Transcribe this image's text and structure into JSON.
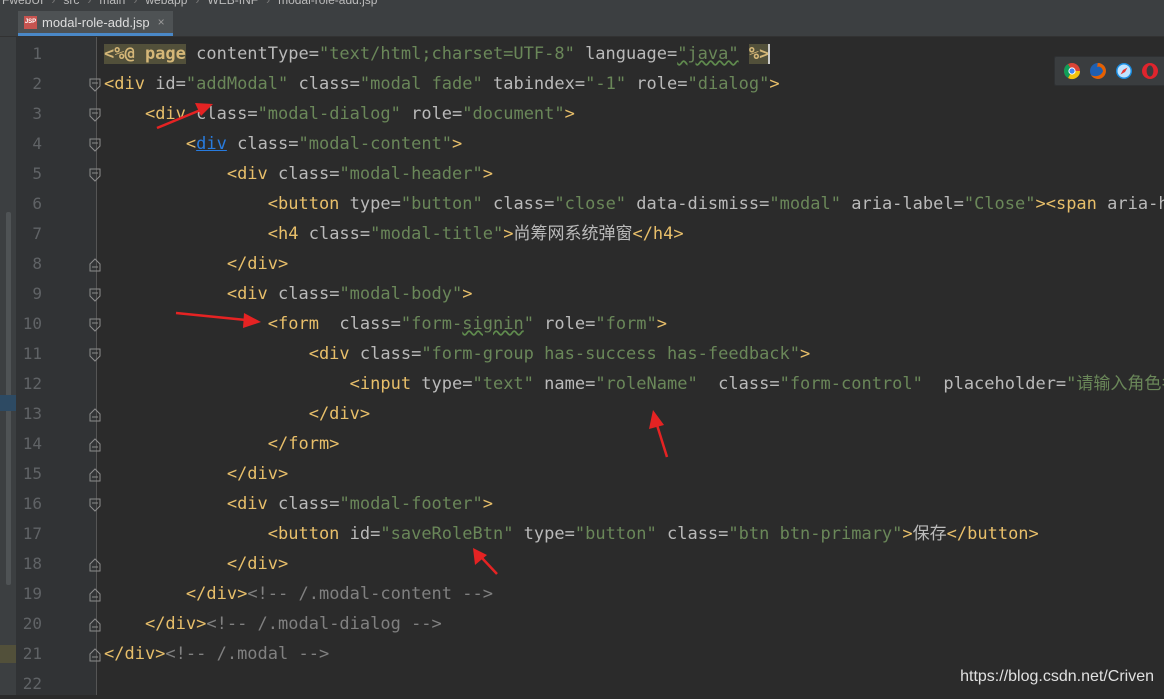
{
  "breadcrumb": [
    "FwebUI",
    "src",
    "main",
    "webapp",
    "WEB-INF",
    "modal-role-add.jsp"
  ],
  "tab": {
    "icon_label": "JSP",
    "label": "modal-role-add.jsp",
    "close": "×"
  },
  "browser_icons": [
    "chrome-icon",
    "firefox-icon",
    "safari-icon",
    "opera-icon"
  ],
  "watermark": "https://blog.csdn.net/Criven",
  "lines": [
    {
      "num": "1",
      "fold": "",
      "tokens": [
        [
          "hl",
          "<%@ page"
        ],
        [
          "a",
          " contentType="
        ],
        [
          "v",
          "\"text/html;charset=UTF-8\""
        ],
        [
          "a",
          " language="
        ],
        [
          "vt",
          "\"java\""
        ],
        [
          "a",
          " "
        ],
        [
          "hl",
          "%>"
        ],
        [
          "cur",
          ""
        ]
      ]
    },
    {
      "num": "2",
      "fold": "open",
      "tokens": [
        [
          "t",
          "<div"
        ],
        [
          "a",
          " id="
        ],
        [
          "v",
          "\"addModal\""
        ],
        [
          "a",
          " class="
        ],
        [
          "v",
          "\"modal fade\""
        ],
        [
          "a",
          " tabindex="
        ],
        [
          "v",
          "\"-1\""
        ],
        [
          "a",
          " role="
        ],
        [
          "v",
          "\"dialog\""
        ],
        [
          "t",
          ">"
        ]
      ]
    },
    {
      "num": "3",
      "fold": "open",
      "tokens": [
        [
          "p",
          "    "
        ],
        [
          "t",
          "<div"
        ],
        [
          "a",
          " class="
        ],
        [
          "v",
          "\"modal-dialog\""
        ],
        [
          "a",
          " role="
        ],
        [
          "v",
          "\"document\""
        ],
        [
          "t",
          ">"
        ]
      ]
    },
    {
      "num": "4",
      "fold": "open",
      "tokens": [
        [
          "p",
          "        "
        ],
        [
          "t",
          "<"
        ],
        [
          "l",
          "div"
        ],
        [
          "a",
          " class="
        ],
        [
          "v",
          "\"modal-content\""
        ],
        [
          "t",
          ">"
        ]
      ]
    },
    {
      "num": "5",
      "fold": "open",
      "tokens": [
        [
          "p",
          "            "
        ],
        [
          "t",
          "<div"
        ],
        [
          "a",
          " class="
        ],
        [
          "v",
          "\"modal-header\""
        ],
        [
          "t",
          ">"
        ]
      ]
    },
    {
      "num": "6",
      "fold": "",
      "tokens": [
        [
          "p",
          "                "
        ],
        [
          "t",
          "<button"
        ],
        [
          "a",
          " type="
        ],
        [
          "v",
          "\"button\""
        ],
        [
          "a",
          " class="
        ],
        [
          "v",
          "\"close\""
        ],
        [
          "a",
          " data-dismiss="
        ],
        [
          "v",
          "\"modal\""
        ],
        [
          "a",
          " aria-label="
        ],
        [
          "v",
          "\"Close\""
        ],
        [
          "t",
          "><span"
        ],
        [
          "a",
          " aria-hid"
        ]
      ]
    },
    {
      "num": "7",
      "fold": "",
      "tokens": [
        [
          "p",
          "                "
        ],
        [
          "t",
          "<h4"
        ],
        [
          "a",
          " class="
        ],
        [
          "v",
          "\"modal-title\""
        ],
        [
          "t",
          ">"
        ],
        [
          "x",
          "尚筹网系统弹窗"
        ],
        [
          "t",
          "</h4>"
        ]
      ]
    },
    {
      "num": "8",
      "fold": "close",
      "tokens": [
        [
          "p",
          "            "
        ],
        [
          "t",
          "</div>"
        ]
      ]
    },
    {
      "num": "9",
      "fold": "open",
      "tokens": [
        [
          "p",
          "            "
        ],
        [
          "t",
          "<div"
        ],
        [
          "a",
          " class="
        ],
        [
          "v",
          "\"modal-body\""
        ],
        [
          "t",
          ">"
        ]
      ]
    },
    {
      "num": "10",
      "fold": "open",
      "tokens": [
        [
          "p",
          "                "
        ],
        [
          "t",
          "<form"
        ],
        [
          "a",
          "  class="
        ],
        [
          "v",
          "\"form-"
        ],
        [
          "vt",
          "signin"
        ],
        [
          "v",
          "\""
        ],
        [
          "a",
          " role="
        ],
        [
          "v",
          "\"form\""
        ],
        [
          "t",
          ">"
        ]
      ]
    },
    {
      "num": "11",
      "fold": "open",
      "tokens": [
        [
          "p",
          "                    "
        ],
        [
          "t",
          "<div"
        ],
        [
          "a",
          " class="
        ],
        [
          "v",
          "\"form-group has-success has-feedback\""
        ],
        [
          "t",
          ">"
        ]
      ]
    },
    {
      "num": "12",
      "fold": "",
      "tokens": [
        [
          "p",
          "                        "
        ],
        [
          "t",
          "<input"
        ],
        [
          "a",
          " type="
        ],
        [
          "v",
          "\"text\""
        ],
        [
          "a",
          " name="
        ],
        [
          "v",
          "\"roleName\""
        ],
        [
          "a",
          "  class="
        ],
        [
          "v",
          "\"form-control\""
        ],
        [
          "a",
          "  placeholder="
        ],
        [
          "v",
          "\"请输入角色名"
        ]
      ]
    },
    {
      "num": "13",
      "fold": "close",
      "tokens": [
        [
          "p",
          "                    "
        ],
        [
          "t",
          "</div>"
        ]
      ]
    },
    {
      "num": "14",
      "fold": "close",
      "tokens": [
        [
          "p",
          "                "
        ],
        [
          "t",
          "</form>"
        ]
      ]
    },
    {
      "num": "15",
      "fold": "close",
      "tokens": [
        [
          "p",
          "            "
        ],
        [
          "t",
          "</div>"
        ]
      ]
    },
    {
      "num": "16",
      "fold": "open",
      "tokens": [
        [
          "p",
          "            "
        ],
        [
          "t",
          "<div"
        ],
        [
          "a",
          " class="
        ],
        [
          "v",
          "\"modal-footer\""
        ],
        [
          "t",
          ">"
        ]
      ]
    },
    {
      "num": "17",
      "fold": "",
      "tokens": [
        [
          "p",
          "                "
        ],
        [
          "t",
          "<button"
        ],
        [
          "a",
          " id="
        ],
        [
          "v",
          "\"saveRoleBtn\""
        ],
        [
          "a",
          " type="
        ],
        [
          "v",
          "\"button\""
        ],
        [
          "a",
          " class="
        ],
        [
          "v",
          "\"btn btn-primary\""
        ],
        [
          "t",
          ">"
        ],
        [
          "x",
          "保存"
        ],
        [
          "t",
          "</button>"
        ]
      ]
    },
    {
      "num": "18",
      "fold": "close",
      "tokens": [
        [
          "p",
          "            "
        ],
        [
          "t",
          "</div>"
        ]
      ]
    },
    {
      "num": "19",
      "fold": "close",
      "tokens": [
        [
          "p",
          "        "
        ],
        [
          "t",
          "</div>"
        ],
        [
          "c",
          "<!-- /.modal-content -->"
        ]
      ]
    },
    {
      "num": "20",
      "fold": "close",
      "tokens": [
        [
          "p",
          "    "
        ],
        [
          "t",
          "</div>"
        ],
        [
          "c",
          "<!-- /.modal-dialog -->"
        ]
      ]
    },
    {
      "num": "21",
      "fold": "close",
      "tokens": [
        [
          "t",
          "</div>"
        ],
        [
          "c",
          "<!-- /.modal -->"
        ]
      ]
    },
    {
      "num": "22",
      "fold": "",
      "tokens": []
    }
  ]
}
